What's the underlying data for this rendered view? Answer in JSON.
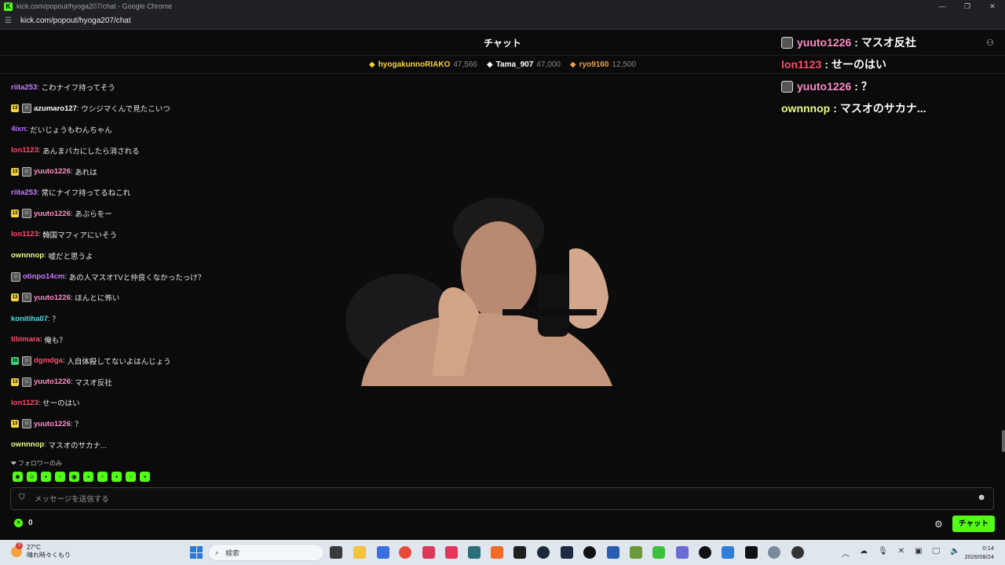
{
  "browser": {
    "window_title": "kick.com/popout/hyoga207/chat - Google Chrome",
    "url": "kick.com/popout/hyoga207/chat",
    "logo_letter": "K"
  },
  "chat": {
    "header_title": "チャット",
    "leaderboard": [
      {
        "name": "hyogakunnoRIAKO",
        "points": "47,566",
        "color": "#f5d33b"
      },
      {
        "name": "Tama_907",
        "points": "47,000",
        "color": "#ffffff"
      },
      {
        "name": "ryo9160",
        "points": "12,500",
        "color": "#e8a24a"
      }
    ],
    "messages": [
      {
        "badges": [],
        "user": "riita253",
        "color": "#c77dff",
        "text": "こわナイフ持ってそう"
      },
      {
        "badges": [
          "sub",
          "avatar"
        ],
        "sub_label": "13",
        "user": "azumaro127",
        "color": "#ffffff",
        "text": "ウシジマくんで見たこいつ"
      },
      {
        "badges": [],
        "user": "4ixn",
        "color": "#b46cff",
        "text": "だいじょうもわんちゃん"
      },
      {
        "badges": [],
        "user": "lon1123",
        "color": "#ff4d6d",
        "text": "あんまバカにしたら消される"
      },
      {
        "badges": [
          "sub",
          "avatar"
        ],
        "sub_label": "13",
        "user": "yuuto1226",
        "color": "#ff8fc7",
        "text": "あれは"
      },
      {
        "badges": [],
        "user": "riita253",
        "color": "#c77dff",
        "text": "常にナイフ持ってるねこれ"
      },
      {
        "badges": [
          "sub",
          "avatar"
        ],
        "sub_label": "13",
        "user": "yuuto1226",
        "color": "#ff8fc7",
        "text": "あぶらをー"
      },
      {
        "badges": [],
        "user": "lon1123",
        "color": "#ff4d6d",
        "text": "韓国マフィアにいそう"
      },
      {
        "badges": [],
        "user": "ownnnop",
        "color": "#e9ff8a",
        "text": "嘘だと思うよ"
      },
      {
        "badges": [
          "avatar"
        ],
        "user": "otinpo14cm",
        "color": "#c77dff",
        "text": "あの人マスオTVと仲良くなかったっけ？"
      },
      {
        "badges": [
          "sub",
          "avatar"
        ],
        "sub_label": "13",
        "user": "yuuto1226",
        "color": "#ff8fc7",
        "text": "ほんとに怖い"
      },
      {
        "badges": [],
        "user": "konitiha07",
        "color": "#4ee0e8",
        "text": "？"
      },
      {
        "badges": [],
        "user": "tibimara",
        "color": "#ff4d6d",
        "text": "俺も？"
      },
      {
        "badges": [
          "sub",
          "avatar"
        ],
        "sub_label": "16",
        "user": "dgmdga",
        "color": "#ff4d6d",
        "text": "人自体殺してないよはんじょう"
      },
      {
        "badges": [
          "sub",
          "avatar"
        ],
        "sub_label": "13",
        "user": "yuuto1226",
        "color": "#ff8fc7",
        "text": "マスオ反社"
      },
      {
        "badges": [],
        "user": "lon1123",
        "color": "#ff4d6d",
        "text": "せーのはい"
      },
      {
        "badges": [
          "sub",
          "avatar"
        ],
        "sub_label": "13",
        "user": "yuuto1226",
        "color": "#ff8fc7",
        "text": "？"
      },
      {
        "badges": [],
        "user": "ownnnop",
        "color": "#e9ff8a",
        "text": "マスオのサカナ..."
      }
    ],
    "followers_only_label": "フォロワーのみ",
    "input_placeholder": "メッセージを送信する",
    "points_count": "0",
    "send_button_label": "チャット",
    "accent_color": "#53fc18"
  },
  "overlay": [
    {
      "avatar": true,
      "user": "yuuto1226",
      "color": "#ff8fc7",
      "text": "マスオ反社"
    },
    {
      "avatar": false,
      "user": "lon1123",
      "color": "#ff4d6d",
      "text": "せーのはい"
    },
    {
      "avatar": true,
      "user": "yuuto1226",
      "color": "#ff8fc7",
      "text": "？"
    },
    {
      "avatar": false,
      "user": "ownnnop",
      "color": "#e9ff8a",
      "text": "マスオのサカナ..."
    }
  ],
  "taskbar": {
    "weather_badge": "2",
    "temperature": "27°C",
    "weather_text": "晴れ時々くもり",
    "search_placeholder": "検索",
    "time": "0:14",
    "date": "2026/08/24"
  }
}
